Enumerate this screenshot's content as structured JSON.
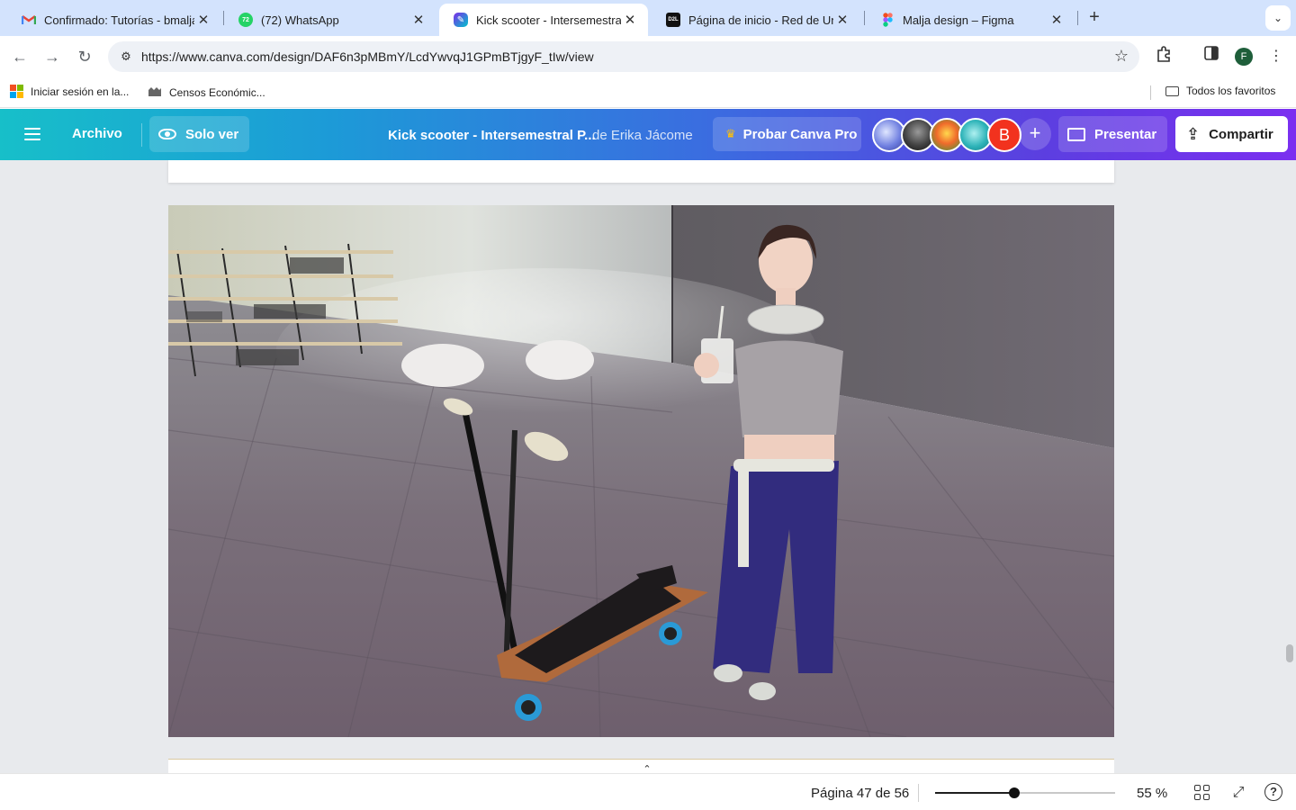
{
  "browser": {
    "tabs": [
      {
        "title": "Confirmado: Tutorías - bmalja",
        "icon": "gmail-icon",
        "active": false
      },
      {
        "title": "(72) WhatsApp",
        "icon": "whatsapp-icon",
        "badge": "72",
        "active": false
      },
      {
        "title": "Kick scooter - Intersemestral",
        "icon": "canva-icon",
        "active": true
      },
      {
        "title": "Página de inicio - Red de Univ",
        "icon": "d2l-icon",
        "favicon_text": "D2L",
        "active": false
      },
      {
        "title": "Malja design – Figma",
        "icon": "figma-icon",
        "active": false
      }
    ],
    "new_tab_label": "+",
    "address": {
      "url": "https://www.canva.com/design/DAF6n3pMBmY/LcdYwvqJ1GPmBTjgyF_tIw/view"
    },
    "profile_initial": "F",
    "bookmarks": [
      {
        "label": "Iniciar sesión en la...",
        "icon": "microsoft-icon"
      },
      {
        "label": "Censos Económic...",
        "icon": "census-icon"
      }
    ],
    "all_bookmarks_label": "Todos los favoritos"
  },
  "canva": {
    "menu_label": "Archivo",
    "view_mode_label": "Solo ver",
    "doc_title": "Kick scooter - Intersemestral P...",
    "doc_author": "de Erika Jácome",
    "pro_label": "Probar Canva Pro",
    "collaborators": [
      {
        "name": "avatar-1"
      },
      {
        "name": "avatar-2"
      },
      {
        "name": "avatar-3"
      },
      {
        "name": "avatar-4"
      },
      {
        "name": "avatar-5",
        "initial": "B"
      }
    ],
    "add_collab_label": "+",
    "present_label": "Presentar",
    "share_label": "Compartir",
    "page_info": "Página 47 de 56",
    "zoom_label": "55 %",
    "zoom_fraction": 0.44,
    "colors": {
      "header_start": "#17bfc9",
      "header_end": "#7b2ff0",
      "workspace": "#e8eaed"
    }
  }
}
